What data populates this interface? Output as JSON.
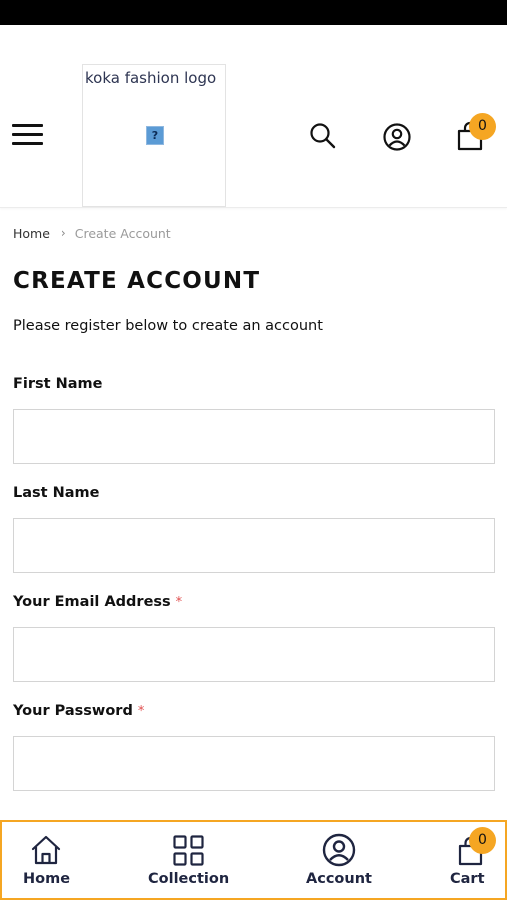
{
  "header": {
    "logo_alt": "koka fashion logo",
    "broken_image_glyph": "?",
    "icons": [
      "menu-icon",
      "search-icon",
      "account-icon",
      "cart-icon"
    ],
    "cart_count": "0"
  },
  "breadcrumb": {
    "home": "Home",
    "separator": "›",
    "current": "Create Account"
  },
  "page": {
    "title": "CREATE ACCOUNT",
    "intro": "Please register below to create an account"
  },
  "form": {
    "first_name": {
      "label": "First Name",
      "value": ""
    },
    "last_name": {
      "label": "Last Name",
      "value": ""
    },
    "email": {
      "label": "Your Email Address",
      "required_mark": "*",
      "value": ""
    },
    "password": {
      "label": "Your Password",
      "required_mark": "*",
      "value": ""
    }
  },
  "bottom_nav": {
    "items": [
      {
        "label": "Home",
        "icon": "home-icon"
      },
      {
        "label": "Collection",
        "icon": "grid-icon"
      },
      {
        "label": "Account",
        "icon": "account-icon"
      },
      {
        "label": "Cart",
        "icon": "cart-icon"
      }
    ],
    "cart_count": "0"
  },
  "colors": {
    "accent": "#f5a623",
    "required": "#e05050",
    "nav_text": "#1f2540",
    "status_bar": "#000000"
  }
}
